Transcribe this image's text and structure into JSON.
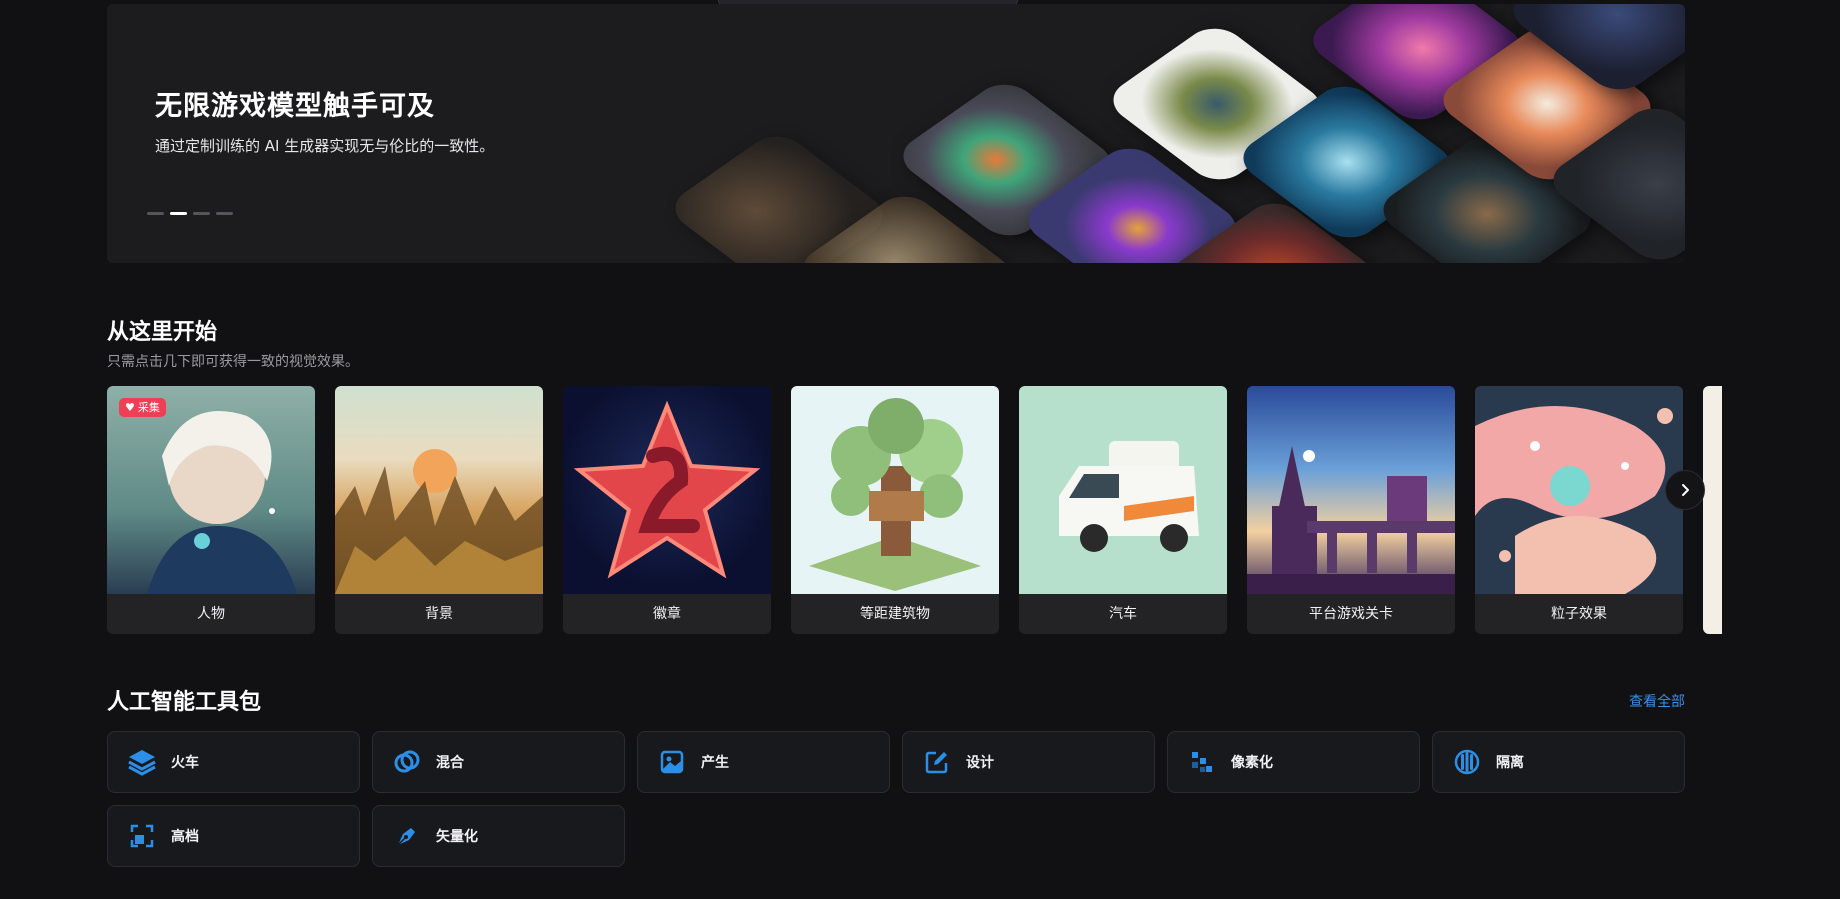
{
  "hero": {
    "title": "无限游戏模型触手可及",
    "subtitle": "通过定制训练的 AI 生成器实现无与伦比的一致性。",
    "active_slide": 2,
    "slide_count": 4
  },
  "start": {
    "title": "从这里开始",
    "subtitle": "只需点击几下即可获得一致的视觉效果。",
    "cards": [
      {
        "label": "人物",
        "badge": "采集"
      },
      {
        "label": "背景"
      },
      {
        "label": "徽章"
      },
      {
        "label": "等距建筑物"
      },
      {
        "label": "汽车"
      },
      {
        "label": "平台游戏关卡"
      },
      {
        "label": "粒子效果"
      }
    ]
  },
  "toolkit": {
    "title": "人工智能工具包",
    "see_all": "查看全部",
    "tools": [
      {
        "label": "火车",
        "icon": "layers-icon"
      },
      {
        "label": "混合",
        "icon": "blend-rings-icon"
      },
      {
        "label": "产生",
        "icon": "image-icon"
      },
      {
        "label": "设计",
        "icon": "edit-icon"
      },
      {
        "label": "像素化",
        "icon": "pixel-icon"
      },
      {
        "label": "隔离",
        "icon": "isolate-icon"
      },
      {
        "label": "高档",
        "icon": "upscale-icon"
      },
      {
        "label": "矢量化",
        "icon": "pen-nib-icon"
      }
    ]
  },
  "colors": {
    "accent": "#3b8ee6",
    "badge": "#ef3e56",
    "background": "#111113"
  }
}
